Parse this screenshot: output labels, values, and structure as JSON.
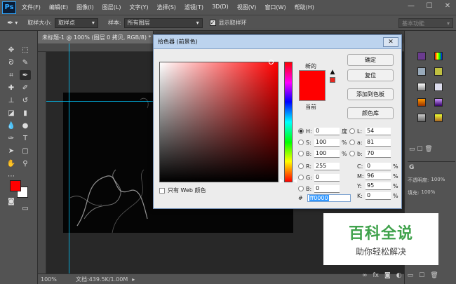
{
  "menubar": {
    "logo": "Ps",
    "items": [
      "文件(F)",
      "编辑(E)",
      "图像(I)",
      "图层(L)",
      "文字(Y)",
      "选择(S)",
      "滤镜(T)",
      "3D(D)",
      "视图(V)",
      "窗口(W)",
      "帮助(H)"
    ],
    "window_controls": [
      "—",
      "☐",
      "✕"
    ]
  },
  "optionsbar": {
    "sample_size_label": "取样大小:",
    "sample_size_value": "取样点",
    "sample_label": "样本:",
    "sample_value": "所有图层",
    "show_ring_label": "显示取样环",
    "workspace": "基本功能"
  },
  "document": {
    "tab_title": "未标题-1 @ 100% (图层 0 拷贝, RGB/8) *",
    "zoom": "100%",
    "doc_info": "文档:439.5K/1.00M"
  },
  "dialog": {
    "title": "拾色器 (前景色)",
    "close": "✕",
    "new_label": "新的",
    "current_label": "当前",
    "buttons": {
      "ok": "确定",
      "reset": "复位",
      "add_to_swatches": "添加到色板",
      "color_libraries": "颜色库"
    },
    "fields": {
      "H": {
        "label": "H:",
        "value": "0",
        "unit": "度"
      },
      "S": {
        "label": "S:",
        "value": "100",
        "unit": "%"
      },
      "B": {
        "label": "B:",
        "value": "100",
        "unit": "%"
      },
      "R": {
        "label": "R:",
        "value": "255"
      },
      "G": {
        "label": "G:",
        "value": "0"
      },
      "Bl": {
        "label": "B:",
        "value": "0"
      },
      "L": {
        "label": "L:",
        "value": "54"
      },
      "a": {
        "label": "a:",
        "value": "81"
      },
      "b": {
        "label": "b:",
        "value": "70"
      },
      "C": {
        "label": "C:",
        "value": "0",
        "unit": "%"
      },
      "M": {
        "label": "M:",
        "value": "96",
        "unit": "%"
      },
      "Y": {
        "label": "Y:",
        "value": "95",
        "unit": "%"
      },
      "K": {
        "label": "K:",
        "value": "0",
        "unit": "%"
      }
    },
    "web_only_label": "只有 Web 颜色",
    "hex_label": "#",
    "hex_value": "ff0000",
    "selected_color": "#ff0000"
  },
  "rightpanel": {
    "label_opacity": "不透明度:",
    "label_fill": "填充:",
    "opacity_value": "100%",
    "fill_value": "100%",
    "label_G": "G"
  },
  "watermark": {
    "title": "百科全说",
    "subtitle": "助你轻松解决"
  },
  "colors": {
    "foreground": "#ff0000",
    "background": "#ffffff"
  }
}
